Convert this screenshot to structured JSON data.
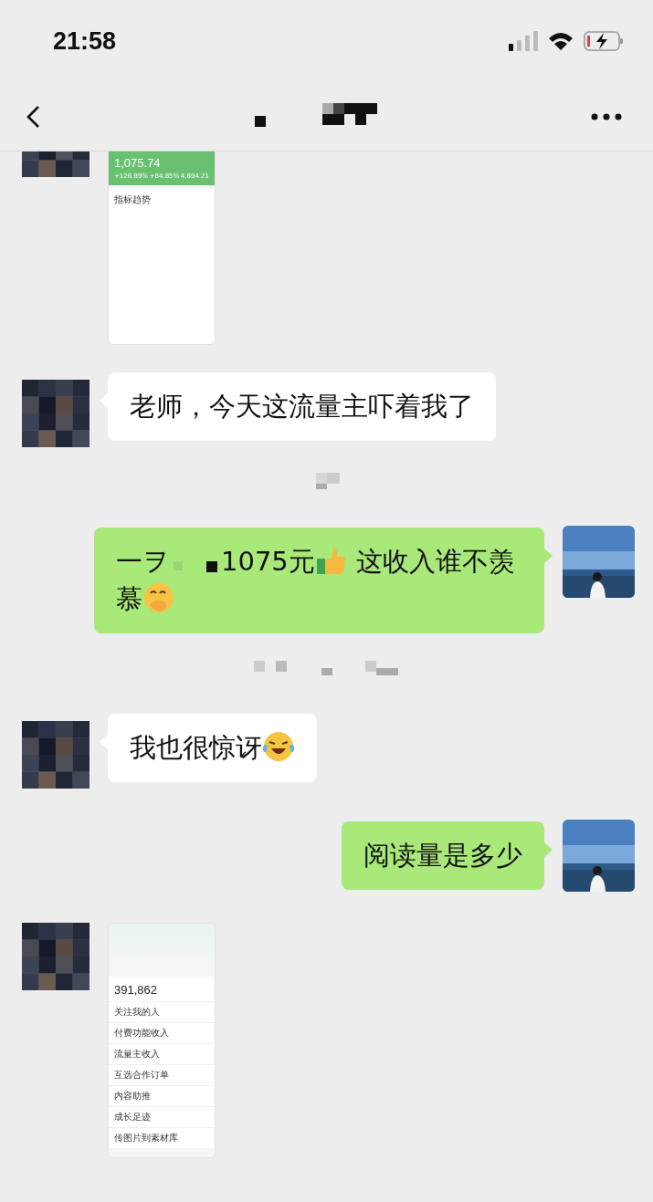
{
  "status_bar": {
    "time": "21:58"
  },
  "messages": [
    {
      "outgoing": false,
      "image": {
        "kind": "earnings",
        "total": "1,075.74",
        "stats": [
          "+126.89%",
          "+84.85%",
          "4,694.21"
        ],
        "section": "指标趋势"
      }
    },
    {
      "kind": "text",
      "outgoing": false,
      "parts": [
        {
          "kind": "text",
          "text": "老师，今天这流量主吓着我了"
        }
      ]
    },
    {
      "kind": "timestamp"
    },
    {
      "kind": "text",
      "outgoing": true,
      "parts": [
        {
          "kind": "text",
          "text": "一ヲ"
        },
        {
          "kind": "mosaic"
        },
        {
          "kind": "text",
          "text": "1075元"
        },
        {
          "kind": "thumbs"
        },
        {
          "kind": "text",
          "text": "这收入谁不羡"
        },
        {
          "kind": "text",
          "text": "慕"
        },
        {
          "kind": "peek"
        }
      ]
    },
    {
      "kind": "timestamp"
    },
    {
      "kind": "text",
      "outgoing": false,
      "parts": [
        {
          "kind": "text",
          "text": "我也很惊讶"
        },
        {
          "kind": "laugh"
        }
      ]
    },
    {
      "kind": "text",
      "outgoing": true,
      "parts": [
        {
          "kind": "text",
          "text": "阅读量是多少"
        }
      ]
    },
    {
      "outgoing": false,
      "image": {
        "kind": "profile",
        "total": "391,862",
        "rows": [
          "关注我的人",
          "付费功能收入",
          "流量主收入",
          "互选合作订单",
          "内容助推",
          "成长足迹",
          "传图片到素材库"
        ]
      }
    }
  ]
}
